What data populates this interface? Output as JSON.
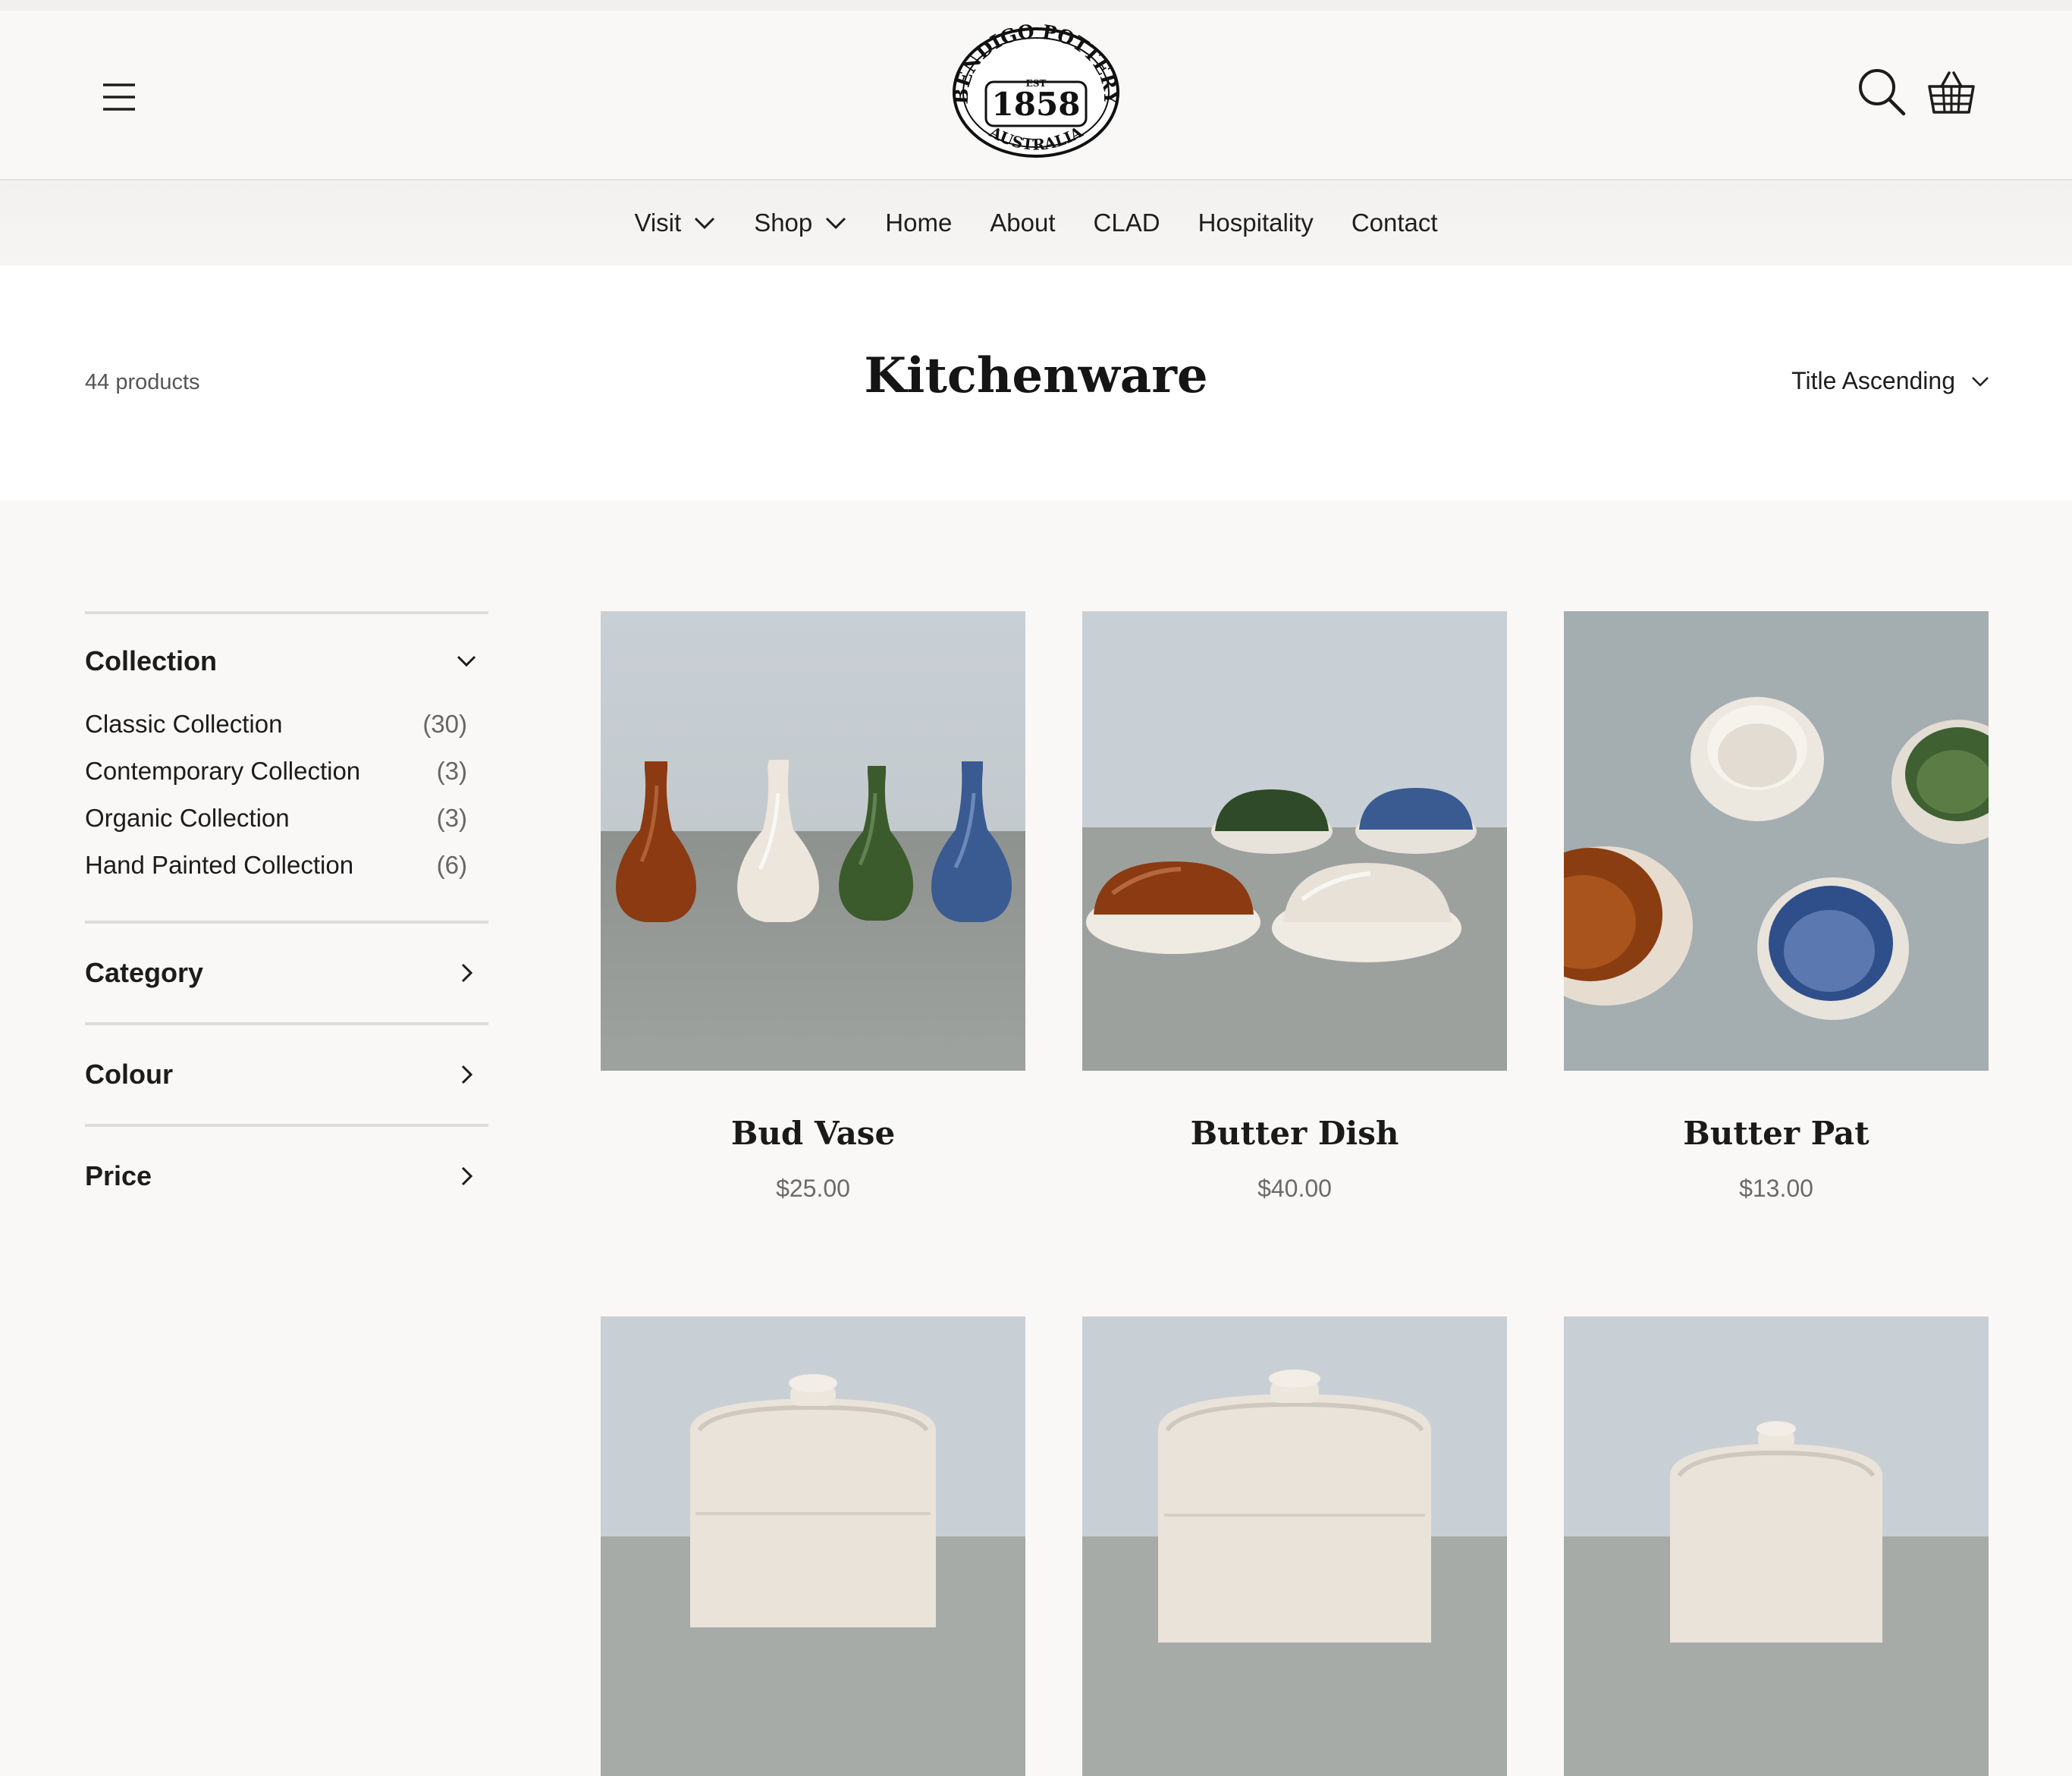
{
  "header": {
    "menu_icon": "hamburger-menu-icon",
    "search_icon": "search-icon",
    "cart_icon": "basket-cart-icon",
    "logo": {
      "brand": "BENDIGO POTTERY",
      "est": "EST",
      "year": "1858",
      "country": "AUSTRALIA"
    }
  },
  "nav": {
    "items": [
      {
        "label": "Visit",
        "dropdown": true
      },
      {
        "label": "Shop",
        "dropdown": true
      },
      {
        "label": "Home",
        "dropdown": false
      },
      {
        "label": "About",
        "dropdown": false
      },
      {
        "label": "CLAD",
        "dropdown": false
      },
      {
        "label": "Hospitality",
        "dropdown": false
      },
      {
        "label": "Contact",
        "dropdown": false
      }
    ]
  },
  "collection_page": {
    "product_count": "44 products",
    "title": "Kitchenware",
    "sort_label": "Title Ascending"
  },
  "filters": {
    "collection": {
      "label": "Collection",
      "expanded": true,
      "options": [
        {
          "label": "Classic Collection",
          "count": "(30)"
        },
        {
          "label": "Contemporary Collection",
          "count": "(3)"
        },
        {
          "label": "Organic Collection",
          "count": "(3)"
        },
        {
          "label": "Hand Painted Collection",
          "count": "(6)"
        }
      ]
    },
    "category": {
      "label": "Category",
      "expanded": false
    },
    "colour": {
      "label": "Colour",
      "expanded": false
    },
    "price": {
      "label": "Price",
      "expanded": false
    }
  },
  "products": [
    {
      "name": "Bud Vase",
      "price": "$25.00"
    },
    {
      "name": "Butter Dish",
      "price": "$40.00"
    },
    {
      "name": "Butter Pat",
      "price": "$13.00"
    },
    {
      "name": "",
      "price": ""
    },
    {
      "name": "",
      "price": ""
    },
    {
      "name": "",
      "price": ""
    }
  ],
  "colors": {
    "page_bg": "#faf8f6",
    "title_band_bg": "#ffffff",
    "nav_bg": "#f3f2f0",
    "text": "#1c1c1c",
    "muted_text": "#6a6a6a",
    "glaze_brown": "#8b3a12",
    "glaze_cream": "#ece6dd",
    "glaze_green": "#3b5b2c",
    "glaze_blue": "#3a5a92"
  }
}
